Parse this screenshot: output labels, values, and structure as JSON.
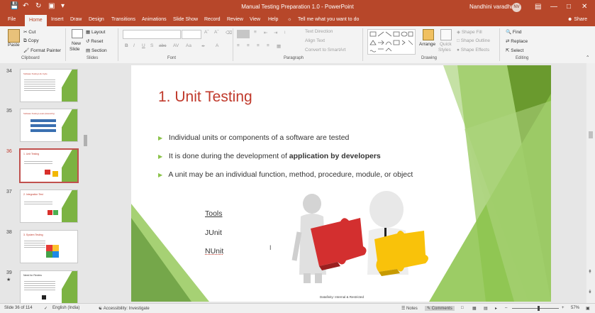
{
  "window": {
    "doc_title": "Manual Testing Preparation 1.0  -  PowerPoint",
    "user_name": "Nandhini varadhan",
    "user_initials": "NV"
  },
  "tabs": [
    "File",
    "Home",
    "Insert",
    "Draw",
    "Design",
    "Transitions",
    "Animations",
    "Slide Show",
    "Record",
    "Review",
    "View",
    "Help"
  ],
  "tell_me": "Tell me what you want to do",
  "share_label": "Share",
  "ribbon": {
    "clipboard": {
      "paste": "Paste",
      "cut": "Cut",
      "copy": "Copy",
      "format_painter": "Format Painter",
      "group": "Clipboard"
    },
    "slides": {
      "new_slide": "New",
      "new_slide2": "Slide",
      "layout": "Layout",
      "reset": "Reset",
      "section": "Section",
      "group": "Slides"
    },
    "font": {
      "group": "Font"
    },
    "paragraph": {
      "text_direction": "Text Direction",
      "align_text": "Align Text",
      "smartart": "Convert to SmartArt",
      "group": "Paragraph"
    },
    "drawing": {
      "arrange": "Arrange",
      "quick_styles": "Quick",
      "quick_styles2": "Styles",
      "shape_fill": "Shape Fill",
      "shape_outline": "Shape Outline",
      "shape_effects": "Shape Effects",
      "group": "Drawing"
    },
    "editing": {
      "find": "Find",
      "replace": "Replace",
      "select": "Select",
      "group": "Editing"
    }
  },
  "thumbnails": [
    {
      "num": "34",
      "title": "Software Testing Life Cycle"
    },
    {
      "num": "35",
      "title": "Software Testing Levels (Hierarchy)"
    },
    {
      "num": "36",
      "title": "1. Unit Testing"
    },
    {
      "num": "37",
      "title": "2. Integration Test"
    },
    {
      "num": "38",
      "title": "3. System Testing"
    },
    {
      "num": "39",
      "title": "Need for Review"
    }
  ],
  "slide": {
    "title": "1. Unit Testing",
    "bullets": [
      {
        "text": "Individual units or components of a software are tested",
        "bold": ""
      },
      {
        "text": "It is done during the development of ",
        "bold": "application by developers"
      },
      {
        "text": "A unit may be an individual function, method, procedure, module, or object",
        "bold": ""
      }
    ],
    "tools_heading": "Tools",
    "tools": [
      "JUnit",
      "NUnit"
    ],
    "footer": "Datafinity: Internal & Restricted"
  },
  "status": {
    "slide_count": "Slide 36 of 114",
    "language": "English (India)",
    "accessibility": "Accessibility: Investigate",
    "notes": "Notes",
    "comments": "Comments",
    "zoom": "57%"
  },
  "colors": {
    "accent": "#b7472a",
    "slide_title": "#c0392b",
    "green": "#7cb342",
    "bullet": "#8bc34a"
  }
}
